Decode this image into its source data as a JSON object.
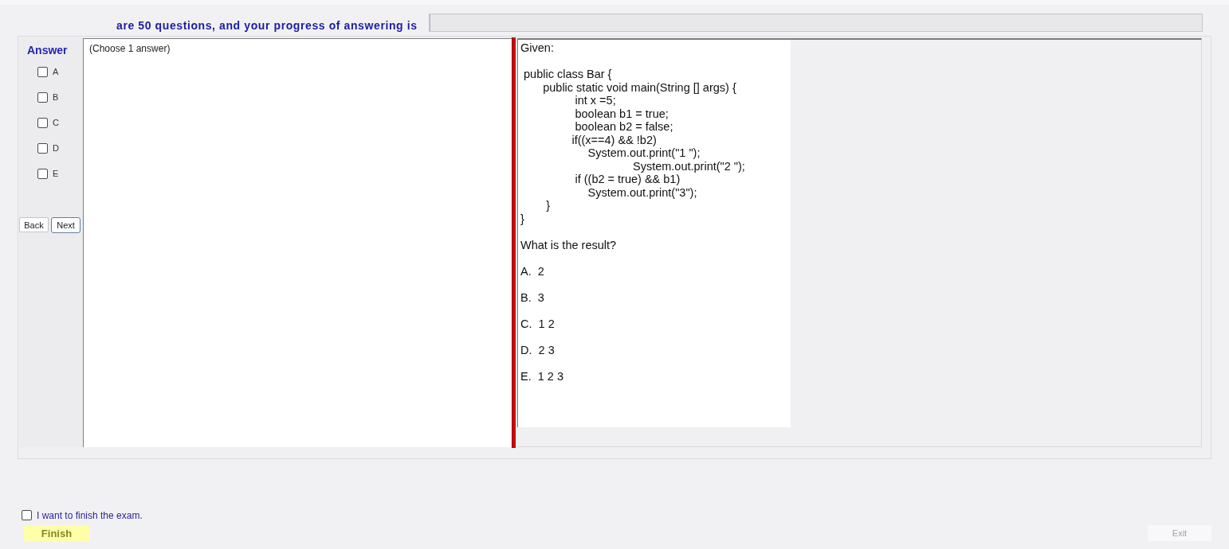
{
  "header": {
    "text": "are 50 questions, and your progress of answering is",
    "progress": {
      "level": 0
    }
  },
  "answer_panel": {
    "title": "Answer",
    "options": [
      {
        "label": "A",
        "checked": false
      },
      {
        "label": "B",
        "checked": false
      },
      {
        "label": "C",
        "checked": false
      },
      {
        "label": "D",
        "checked": false
      },
      {
        "label": "E",
        "checked": false
      }
    ],
    "nav_buttons": [
      {
        "label": "Back",
        "focused": false
      },
      {
        "label": "Next",
        "focused": true
      }
    ]
  },
  "answer_area": {
    "text": "(Choose 1 answer)"
  },
  "question": {
    "intro": "Given:",
    "code": [
      " public class Bar {",
      "       public static void main(String [] args) {",
      "                 int x =5;",
      "                 boolean b1 = true;",
      "                 boolean b2 = false;",
      "                if((x==4) && !b2)",
      "                     System.out.print(\"1 \");",
      "                                   System.out.print(\"2 \");",
      "                 if ((b2 = true) && b1)",
      "                     System.out.print(\"3\");",
      "        }",
      "}"
    ],
    "prompt": "What is the result?",
    "choices": [
      "A.  2",
      "B.  3",
      "C.  1 2",
      "D.  2 3",
      "E.  1 2 3"
    ]
  },
  "footer": {
    "confirm": {
      "label": "I want to finish the exam.",
      "checked": false
    },
    "buttons": [
      {
        "label": "Finish",
        "kind": "finish",
        "disabled": false
      },
      {
        "label": "Exit",
        "kind": "exit",
        "disabled": true
      }
    ]
  }
}
